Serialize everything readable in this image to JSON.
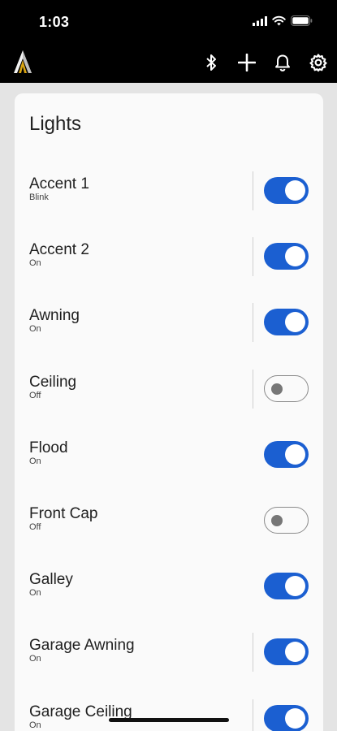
{
  "status_bar": {
    "time": "1:03",
    "icons": [
      "cellular-signal-icon",
      "wifi-icon",
      "battery-icon"
    ]
  },
  "app_bar": {
    "logo": "app-logo",
    "actions": [
      "bluetooth-icon",
      "add-icon",
      "bell-icon",
      "gear-icon"
    ]
  },
  "lights": {
    "title": "Lights",
    "items": [
      {
        "name": "Accent 1",
        "status": "Blink",
        "on": true,
        "divider": true
      },
      {
        "name": "Accent 2",
        "status": "On",
        "on": true,
        "divider": true
      },
      {
        "name": "Awning",
        "status": "On",
        "on": true,
        "divider": true
      },
      {
        "name": "Ceiling",
        "status": "Off",
        "on": false,
        "divider": true
      },
      {
        "name": "Flood",
        "status": "On",
        "on": true,
        "divider": false
      },
      {
        "name": "Front Cap",
        "status": "Off",
        "on": false,
        "divider": false
      },
      {
        "name": "Galley",
        "status": "On",
        "on": true,
        "divider": false
      },
      {
        "name": "Garage Awning",
        "status": "On",
        "on": true,
        "divider": true
      },
      {
        "name": "Garage Ceiling",
        "status": "On",
        "on": true,
        "divider": true
      }
    ]
  },
  "colors": {
    "toggle_on": "#1b5fd1",
    "toggle_off_border": "#8a8a8a",
    "header_bg": "#000000",
    "page_bg": "#e4e4e4",
    "card_bg": "#fafafa"
  }
}
